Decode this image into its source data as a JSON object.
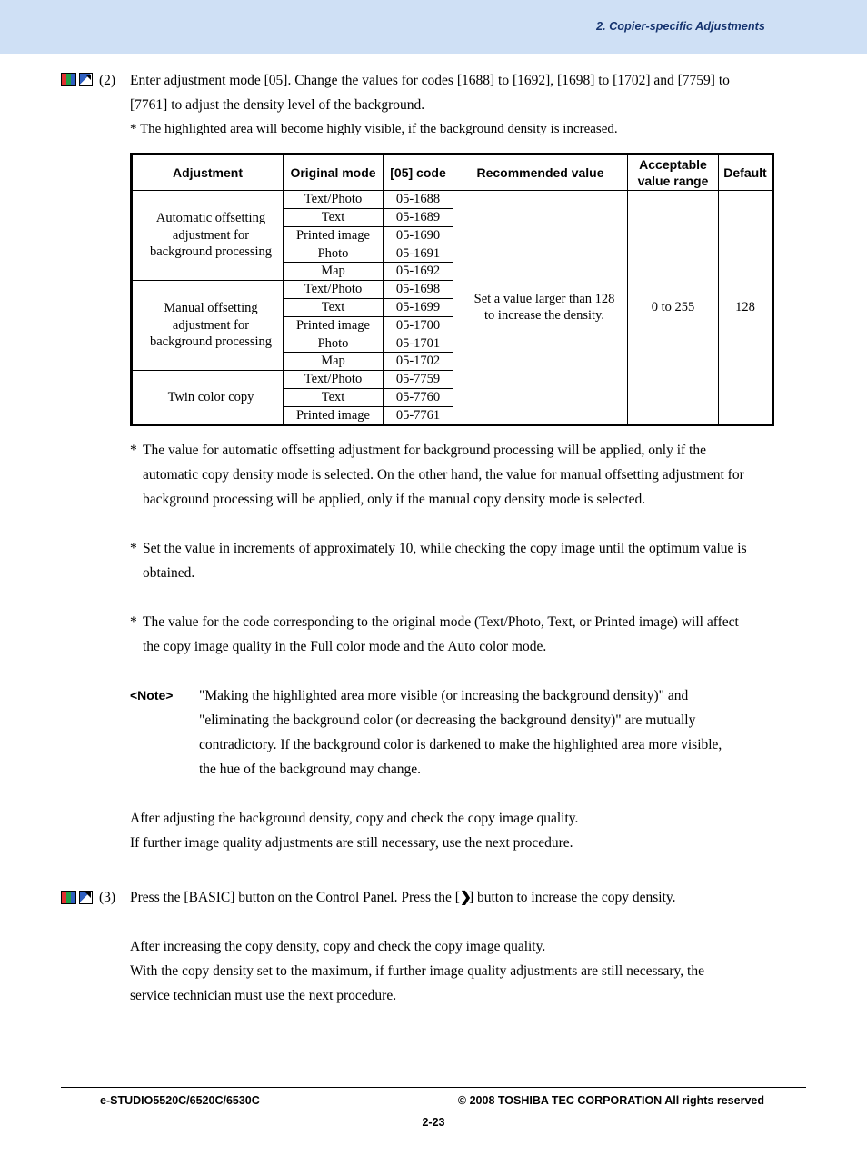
{
  "header": {
    "chapter_title": "2. Copier-specific Adjustments"
  },
  "steps": [
    {
      "number": "(2)",
      "line1": "Enter adjustment mode [05]. Change the values for codes [1688] to [1692], [1698] to [1702] and [7759] to",
      "line2": "[7761] to adjust the density level of the background.",
      "line3": "* The highlighted area will become highly visible, if the background density is increased."
    },
    {
      "number": "(3)",
      "text_before": "Press the [BASIC] button on the Control Panel.  Press the [",
      "arrow": "❯",
      "text_after": "] button to increase the copy density."
    }
  ],
  "table": {
    "headers": [
      "Adjustment",
      "Original mode",
      "[05] code",
      "Recommended value",
      "Acceptable\nvalue range",
      "Default"
    ],
    "header_acceptable_line1": "Acceptable",
    "header_acceptable_line2": "value range",
    "groups": [
      {
        "label_lines": [
          "Automatic offsetting",
          "adjustment for",
          "background processing"
        ],
        "rows": [
          {
            "mode": "Text/Photo",
            "code": "05-1688"
          },
          {
            "mode": "Text",
            "code": "05-1689"
          },
          {
            "mode": "Printed image",
            "code": "05-1690"
          },
          {
            "mode": "Photo",
            "code": "05-1691"
          },
          {
            "mode": "Map",
            "code": "05-1692"
          }
        ]
      },
      {
        "label_lines": [
          "Manual offsetting",
          "adjustment for",
          "background processing"
        ],
        "rows": [
          {
            "mode": "Text/Photo",
            "code": "05-1698"
          },
          {
            "mode": "Text",
            "code": "05-1699"
          },
          {
            "mode": "Printed image",
            "code": "05-1700"
          },
          {
            "mode": "Photo",
            "code": "05-1701"
          },
          {
            "mode": "Map",
            "code": "05-1702"
          }
        ]
      },
      {
        "label_lines": [
          "Twin color copy"
        ],
        "rows": [
          {
            "mode": "Text/Photo",
            "code": "05-7759"
          },
          {
            "mode": "Text",
            "code": "05-7760"
          },
          {
            "mode": "Printed image",
            "code": "05-7761"
          }
        ]
      }
    ],
    "recommended_value_line1": "Set a value larger than 128",
    "recommended_value_line2": "to increase the density.",
    "acceptable_range": "0 to 255",
    "default_value": "128"
  },
  "notes": [
    {
      "star": "*",
      "lines": [
        "The value for automatic offsetting adjustment for background processing will be applied, only if the",
        "automatic copy density mode is selected.  On the other hand, the value for manual offsetting adjustment for",
        "background processing will be applied, only if the manual copy density mode is selected."
      ]
    },
    {
      "star": "*",
      "lines": [
        "Set the value in increments of approximately 10, while checking the copy image until the optimum value is",
        "obtained."
      ]
    },
    {
      "star": "*",
      "lines": [
        "The value for the code corresponding to the original mode (Text/Photo, Text, or Printed image) will affect",
        "the copy image quality in the Full color mode and the Auto color mode."
      ]
    }
  ],
  "note_block": {
    "label": "<Note>",
    "lines": [
      "\"Making the highlighted area more visible (or increasing the background density)\" and",
      "\"eliminating the background color (or decreasing the background density)\" are mutually",
      "contradictory.  If the background color is darkened to make the highlighted area more visible,",
      "the hue of the background may change."
    ]
  },
  "after_note": [
    "After adjusting the background density, copy and check the copy image quality.",
    "If further image quality adjustments are still necessary, use the next procedure."
  ],
  "after_step3": [
    "After increasing the copy density, copy and check the copy image quality.",
    "With the copy density set to the maximum, if further image quality adjustments are still necessary, the",
    "service technician must use the next procedure."
  ],
  "footer": {
    "left": "e-STUDIO5520C/6520C/6530C",
    "right": "© 2008 TOSHIBA TEC CORPORATION All rights reserved",
    "page": "2-23"
  }
}
